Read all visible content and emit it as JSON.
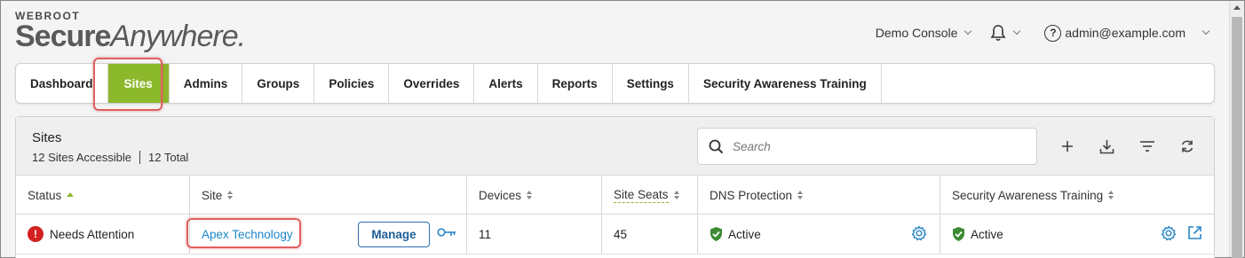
{
  "logo": {
    "top": "WEBROOT",
    "secure": "Secure",
    "anywhere": "Anywhere."
  },
  "header": {
    "console": "Demo Console",
    "user": "admin@example.com"
  },
  "nav": {
    "tabs": [
      {
        "label": "Dashboard"
      },
      {
        "label": "Sites"
      },
      {
        "label": "Admins"
      },
      {
        "label": "Groups"
      },
      {
        "label": "Policies"
      },
      {
        "label": "Overrides"
      },
      {
        "label": "Alerts"
      },
      {
        "label": "Reports"
      },
      {
        "label": "Settings"
      },
      {
        "label": "Security Awareness Training"
      }
    ],
    "active": "Sites"
  },
  "panel": {
    "title": "Sites",
    "accessible": "12 Sites Accessible",
    "total": "12 Total",
    "search_placeholder": "Search"
  },
  "table": {
    "columns": [
      "Status",
      "Site",
      "Devices",
      "Site Seats",
      "DNS Protection",
      "Security Awareness Training"
    ],
    "rows": [
      {
        "status": "Needs Attention",
        "site": "Apex Technology",
        "manage": "Manage",
        "devices": "11",
        "seats": "45",
        "dns": "Active",
        "sat": "Active"
      }
    ]
  },
  "colors": {
    "accent": "#8cb82b",
    "link": "#1a86c8",
    "error": "#d32020",
    "highlight": "#e06060"
  },
  "icons": [
    "bell-icon",
    "help-icon",
    "search-icon",
    "plus-icon",
    "download-icon",
    "filter-icon",
    "refresh-icon",
    "key-icon",
    "shield-check-icon",
    "gear-icon",
    "external-link-icon"
  ]
}
